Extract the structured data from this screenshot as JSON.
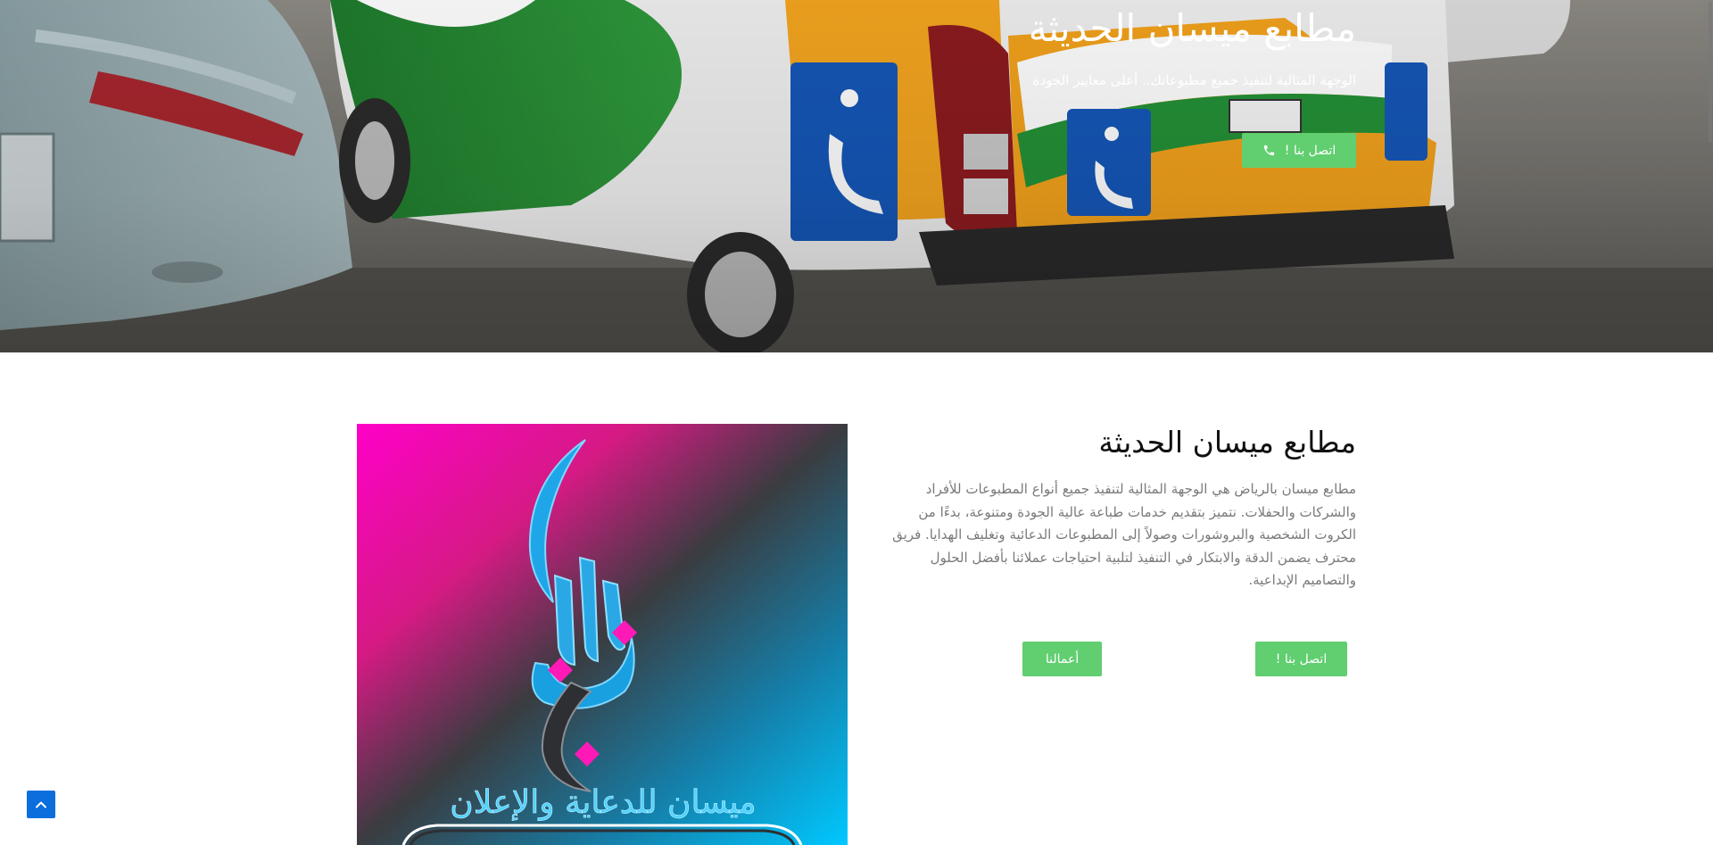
{
  "hero": {
    "title": "مطابع ميسان الحديثة",
    "subtitle": "الوجهة المثالية لتنفيذ جميع مطبوعاتك.. أعلى معايير الجودة",
    "cta_label": "اتصل بنا !",
    "cta_icon": "phone-icon"
  },
  "about": {
    "title": "مطابع ميسان الحديثة",
    "text": "مطابع ميسان بالرياض هي الوجهة المثالية لتنفيذ جميع أنواع المطبوعات للأفراد والشركات والحفلات. نتميز بتقديم خدمات طباعة عالية الجودة ومتنوعة، بدءًا من الكروت الشخصية والبروشورات وصولاً إلى المطبوعات الدعائية وتغليف الهدايا. فريق محترف يضمن الدقة والابتكار في التنفيذ لتلبية احتياجات عملائنا بأفضل الحلول والتصاميم الإبداعية.",
    "contact_button": "اتصل بنا !",
    "works_button": "أعمالنا",
    "logo_text": "ميسان للدعاية والإعلان"
  },
  "back_to_top": {
    "icon": "chevron-up-icon"
  },
  "colors": {
    "accent": "#61ce70",
    "back_to_top": "#0a6edc",
    "logo_pink": "#ff00b4",
    "logo_cyan": "#00c3ff"
  }
}
